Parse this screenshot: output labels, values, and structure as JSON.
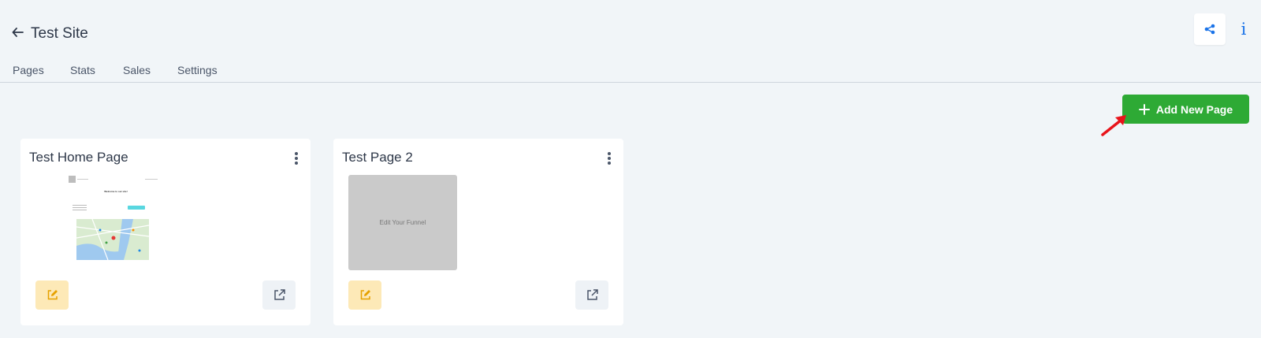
{
  "header": {
    "title": "Test Site",
    "tabs": [
      {
        "label": "Pages"
      },
      {
        "label": "Stats"
      },
      {
        "label": "Sales"
      },
      {
        "label": "Settings"
      }
    ],
    "info_label": "i"
  },
  "actions": {
    "add_page_label": "Add New Page"
  },
  "pages": [
    {
      "title": "Test Home Page",
      "preview_heading": "Welcome to our site!"
    },
    {
      "title": "Test Page 2",
      "placeholder_text": "Edit Your Funnel"
    }
  ],
  "colors": {
    "accent_green": "#2eaa35",
    "link_blue": "#1a73e8",
    "edit_yellow": "#fde9b7",
    "arrow_red": "#e8141b"
  }
}
